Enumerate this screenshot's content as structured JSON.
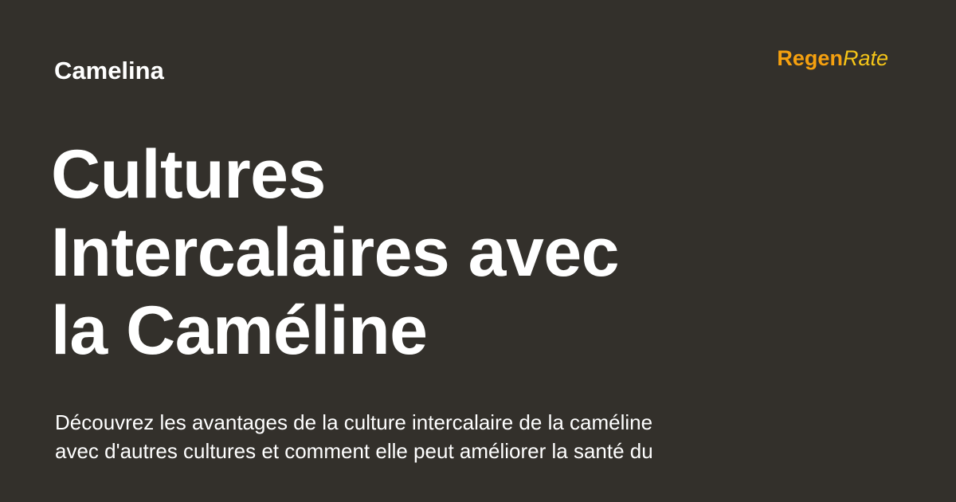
{
  "header": {
    "category": "Camelina",
    "logo": {
      "part1": "Regen",
      "part2": "Rate"
    }
  },
  "title": {
    "lines": [
      "Cultures",
      "Intercalaires avec",
      "la Caméline"
    ]
  },
  "description": {
    "lines": [
      "Découvrez les avantages de la culture intercalaire de la caméline",
      "avec d'autres cultures et comment elle peut améliorer la santé du"
    ]
  },
  "colors": {
    "background": "#33302b",
    "text": "#ffffff",
    "logo_primary": "#f5a00f",
    "logo_secondary": "#f5c518"
  }
}
